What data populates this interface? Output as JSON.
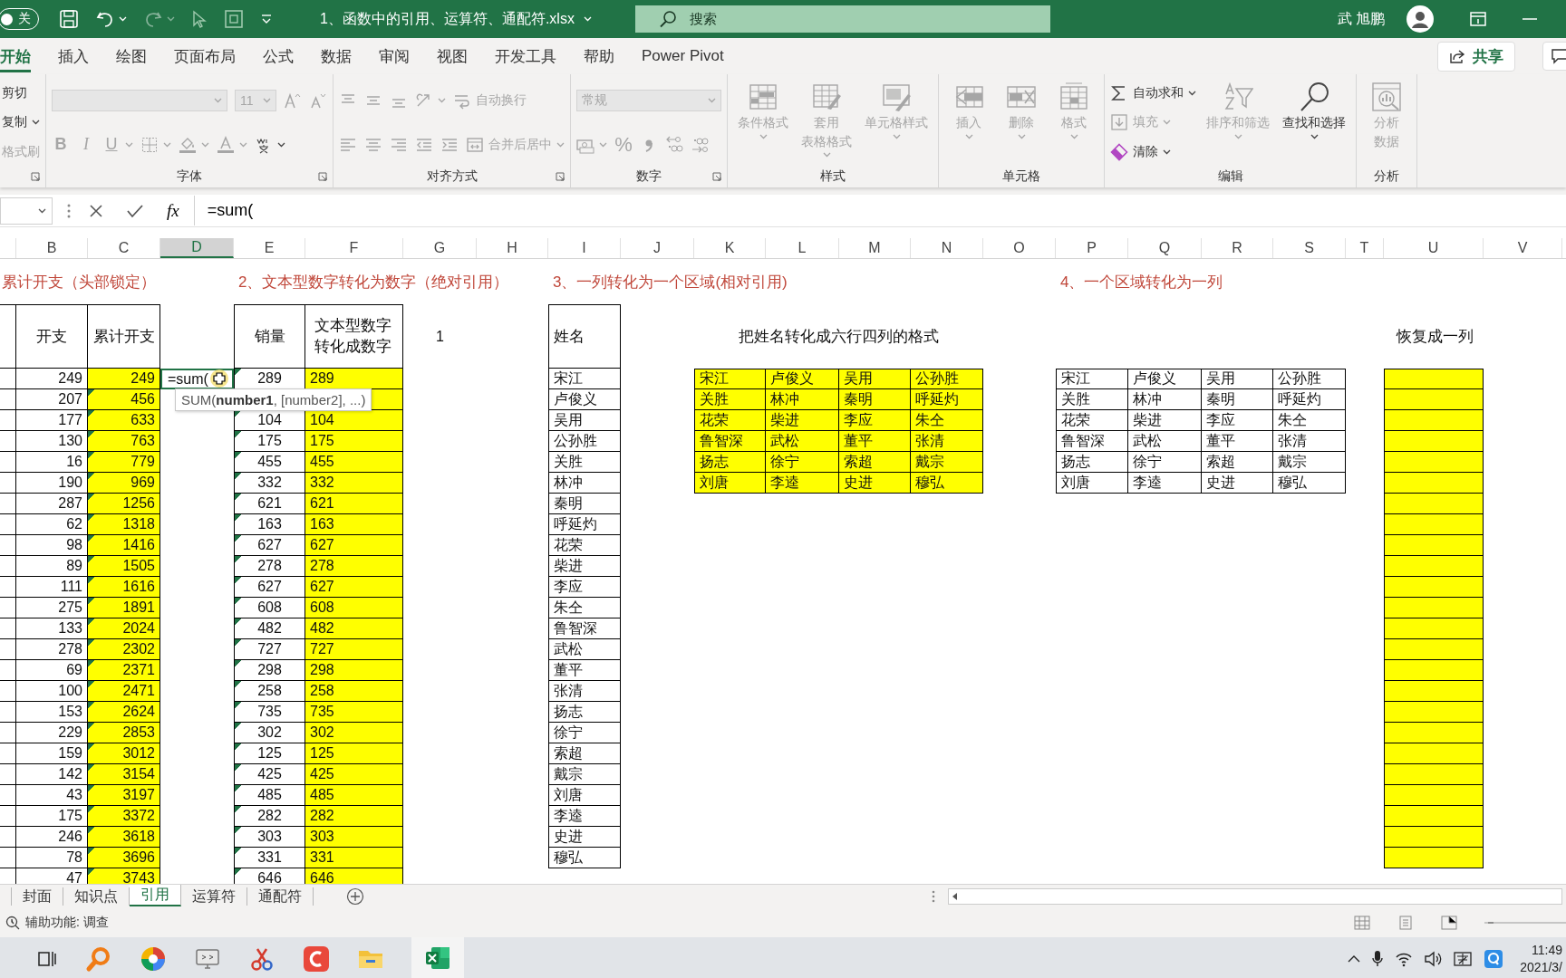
{
  "title_bar": {
    "autosave_label": "关",
    "autosave_on": false,
    "filename": "1、函数中的引用、运算符、通配符.xlsx",
    "search_placeholder": "搜索",
    "user": "武 旭鹏"
  },
  "ribbon_tabs": [
    {
      "label": "开始",
      "selected": true
    },
    {
      "label": "插入",
      "selected": false
    },
    {
      "label": "绘图",
      "selected": false
    },
    {
      "label": "页面布局",
      "selected": false
    },
    {
      "label": "公式",
      "selected": false
    },
    {
      "label": "数据",
      "selected": false
    },
    {
      "label": "审阅",
      "selected": false
    },
    {
      "label": "视图",
      "selected": false
    },
    {
      "label": "开发工具",
      "selected": false
    },
    {
      "label": "帮助",
      "selected": false
    },
    {
      "label": "Power Pivot",
      "selected": false
    }
  ],
  "share_button": "共享",
  "ribbon_groups": [
    {
      "launcher": true,
      "blocks": [
        {
          "rows": [
            [
              {
                "kind": "label",
                "label": "剪切",
                "disabled": false
              }
            ],
            [
              {
                "kind": "label",
                "label": "复制",
                "dropdown": true,
                "disabled": false
              }
            ],
            [
              {
                "kind": "label",
                "label": "格式刷",
                "disabled": true
              }
            ]
          ]
        }
      ]
    },
    {
      "label": "字体",
      "launcher": true,
      "blocks": [
        {
          "rows": [
            [
              {
                "kind": "dropdown",
                "disabled": true
              },
              {
                "kind": "dropdown",
                "value": "11",
                "disabled": true
              },
              {
                "kind": "icon",
                "disabled": true
              },
              {
                "kind": "icon",
                "disabled": true
              }
            ],
            [
              {
                "kind": "char",
                "label": "B",
                "disabled": true
              },
              {
                "kind": "char",
                "label": "I",
                "disabled": true
              },
              {
                "kind": "char",
                "label": "U",
                "dropdown": true,
                "disabled": true
              },
              {
                "kind": "icon",
                "dropdown": true,
                "disabled": true
              },
              {
                "kind": "icon",
                "dropdown": true,
                "disabled": true
              },
              {
                "kind": "icon",
                "dropdown": true,
                "disabled": true
              },
              {
                "kind": "icon",
                "dropdown": true,
                "disabled": false
              }
            ]
          ]
        }
      ]
    },
    {
      "label": "对齐方式",
      "launcher": true,
      "blocks": [
        {
          "rows": [
            [
              {
                "kind": "icon",
                "disabled": true
              },
              {
                "kind": "icon",
                "disabled": true
              },
              {
                "kind": "icon",
                "disabled": true
              },
              {
                "kind": "icon",
                "dropdown": true,
                "disabled": true
              },
              {
                "kind": "small",
                "label": "自动换行",
                "disabled": true
              }
            ],
            [
              {
                "kind": "icon",
                "disabled": true
              },
              {
                "kind": "icon",
                "disabled": true
              },
              {
                "kind": "icon",
                "disabled": true
              },
              {
                "kind": "icon",
                "disabled": true
              },
              {
                "kind": "icon",
                "disabled": true
              },
              {
                "kind": "small",
                "label": "合并后居中",
                "dropdown": true,
                "disabled": true
              }
            ]
          ]
        }
      ]
    },
    {
      "label": "数字",
      "launcher": true,
      "blocks": [
        {
          "rows": [
            [
              {
                "kind": "dropdown",
                "value": "常规",
                "disabled": true
              }
            ],
            [
              {
                "kind": "icon",
                "dropdown": true,
                "disabled": true
              },
              {
                "kind": "char",
                "label": "%",
                "disabled": true
              },
              {
                "kind": "icon",
                "disabled": true
              },
              {
                "kind": "icon",
                "disabled": true
              },
              {
                "kind": "icon",
                "disabled": true
              }
            ]
          ]
        }
      ]
    },
    {
      "label": "样式",
      "blocks": [
        {
          "items": [
            {
              "kind": "large",
              "label": "条件格式",
              "dropdown": true,
              "disabled": true
            },
            {
              "kind": "large",
              "label_lines": [
                "套用",
                "表格格式"
              ],
              "dropdown": true,
              "disabled": true
            },
            {
              "kind": "large",
              "label": "单元格样式",
              "dropdown": true,
              "disabled": true
            }
          ]
        }
      ]
    },
    {
      "label": "单元格",
      "blocks": [
        {
          "items": [
            {
              "kind": "large",
              "label": "插入",
              "dropdown": true,
              "disabled": true
            },
            {
              "kind": "large",
              "label": "删除",
              "dropdown": true,
              "disabled": true
            },
            {
              "kind": "large",
              "label": "格式",
              "dropdown": true,
              "disabled": true
            }
          ]
        }
      ]
    },
    {
      "label": "编辑",
      "blocks": [
        {
          "rows": [
            [
              {
                "kind": "small",
                "label": "自动求和",
                "dropdown": true,
                "disabled": false
              }
            ],
            [
              {
                "kind": "small",
                "label": "填充",
                "dropdown": true,
                "disabled": true
              }
            ],
            [
              {
                "kind": "small",
                "label": "清除",
                "dropdown": true,
                "disabled": false
              }
            ]
          ]
        },
        {
          "items": [
            {
              "kind": "large",
              "label": "排序和筛选",
              "dropdown": true,
              "disabled": true
            },
            {
              "kind": "large",
              "label": "查找和选择",
              "dropdown": true,
              "disabled": false
            }
          ]
        }
      ]
    },
    {
      "label": "分析",
      "blocks": [
        {
          "items": [
            {
              "kind": "large",
              "label_lines": [
                "分析",
                "数据"
              ],
              "disabled": true
            }
          ]
        }
      ]
    }
  ],
  "formula_bar": {
    "fx": "fx",
    "formula": "=sum("
  },
  "sheet": {
    "columns": [
      {
        "label": "B",
        "selected": false
      },
      {
        "label": "C",
        "selected": false
      },
      {
        "label": "D",
        "selected": true
      },
      {
        "label": "E",
        "selected": false
      },
      {
        "label": "F",
        "selected": false
      },
      {
        "label": "G",
        "selected": false
      },
      {
        "label": "H",
        "selected": false
      },
      {
        "label": "I",
        "selected": false
      },
      {
        "label": "J",
        "selected": false
      },
      {
        "label": "K",
        "selected": false
      },
      {
        "label": "L",
        "selected": false
      },
      {
        "label": "M",
        "selected": false
      },
      {
        "label": "N",
        "selected": false
      },
      {
        "label": "O",
        "selected": false
      },
      {
        "label": "P",
        "selected": false
      },
      {
        "label": "Q",
        "selected": false
      },
      {
        "label": "R",
        "selected": false
      },
      {
        "label": "S",
        "selected": false
      },
      {
        "label": "T",
        "selected": false
      },
      {
        "label": "U",
        "selected": false
      },
      {
        "label": "V",
        "selected": false
      }
    ],
    "section_titles": [
      "累计开支（头部锁定）",
      "2、文本型数字转化为数字（绝对引用）",
      "3、一列转化为一个区域(相对引用)",
      "4、一个区域转化为一列"
    ],
    "expenses": {
      "headers": [
        "开支",
        "累计开支"
      ],
      "rows": [
        {
          "expense": "249",
          "total": "249",
          "flagged": false
        },
        {
          "expense": "207",
          "total": "456",
          "flagged": true
        },
        {
          "expense": "177",
          "total": "633",
          "flagged": true
        },
        {
          "expense": "130",
          "total": "763",
          "flagged": true
        },
        {
          "expense": "16",
          "total": "779",
          "flagged": true
        },
        {
          "expense": "190",
          "total": "969",
          "flagged": true
        },
        {
          "expense": "287",
          "total": "1256",
          "flagged": true
        },
        {
          "expense": "62",
          "total": "1318",
          "flagged": true
        },
        {
          "expense": "98",
          "total": "1416",
          "flagged": true
        },
        {
          "expense": "89",
          "total": "1505",
          "flagged": true
        },
        {
          "expense": "111",
          "total": "1616",
          "flagged": true
        },
        {
          "expense": "275",
          "total": "1891",
          "flagged": true
        },
        {
          "expense": "133",
          "total": "2024",
          "flagged": true
        },
        {
          "expense": "278",
          "total": "2302",
          "flagged": true
        },
        {
          "expense": "69",
          "total": "2371",
          "flagged": true
        },
        {
          "expense": "100",
          "total": "2471",
          "flagged": true
        },
        {
          "expense": "153",
          "total": "2624",
          "flagged": true
        },
        {
          "expense": "229",
          "total": "2853",
          "flagged": true
        },
        {
          "expense": "159",
          "total": "3012",
          "flagged": true
        },
        {
          "expense": "142",
          "total": "3154",
          "flagged": true
        },
        {
          "expense": "43",
          "total": "3197",
          "flagged": true
        },
        {
          "expense": "175",
          "total": "3372",
          "flagged": true
        },
        {
          "expense": "246",
          "total": "3618",
          "flagged": true
        },
        {
          "expense": "78",
          "total": "3696",
          "flagged": true
        },
        {
          "expense": "47",
          "total": "3743",
          "flagged": true
        }
      ]
    },
    "active_cell": "=sum(",
    "tooltip": "SUM(**number1**, [number2], ...)",
    "conversion": {
      "headers": [
        "销量",
        "文本型数字转化成数字"
      ],
      "rows": [
        {
          "sales": "289",
          "text": "289",
          "flagged": true
        },
        {},
        {
          "sales": "104",
          "text": "104",
          "flagged": true
        },
        {
          "sales": "175",
          "text": "175",
          "flagged": true
        },
        {
          "sales": "455",
          "text": "455",
          "flagged": true
        },
        {
          "sales": "332",
          "text": "332",
          "flagged": true
        },
        {
          "sales": "621",
          "text": "621",
          "flagged": true
        },
        {
          "sales": "163",
          "text": "163",
          "flagged": true
        },
        {
          "sales": "627",
          "text": "627",
          "flagged": true
        },
        {
          "sales": "278",
          "text": "278",
          "flagged": true
        },
        {
          "sales": "627",
          "text": "627",
          "flagged": true
        },
        {
          "sales": "608",
          "text": "608",
          "flagged": true
        },
        {
          "sales": "482",
          "text": "482",
          "flagged": true
        },
        {
          "sales": "727",
          "text": "727",
          "flagged": true
        },
        {
          "sales": "298",
          "text": "298",
          "flagged": true
        },
        {
          "sales": "258",
          "text": "258",
          "flagged": true
        },
        {
          "sales": "735",
          "text": "735",
          "flagged": true
        },
        {
          "sales": "302",
          "text": "302",
          "flagged": true
        },
        {
          "sales": "125",
          "text": "125",
          "flagged": true
        },
        {
          "sales": "425",
          "text": "425",
          "flagged": true
        },
        {
          "sales": "485",
          "text": "485",
          "flagged": true
        },
        {
          "sales": "282",
          "text": "282",
          "flagged": true
        },
        {
          "sales": "303",
          "text": "303",
          "flagged": true
        },
        {
          "sales": "331",
          "text": "331",
          "flagged": true
        },
        {
          "sales": "646",
          "text": "646",
          "flagged": true
        }
      ]
    },
    "g_value": "1",
    "names": {
      "header": "姓名",
      "rows": [
        "宋江",
        "卢俊义",
        "吴用",
        "公孙胜",
        "关胜",
        "林冲",
        "秦明",
        "呼延灼",
        "花荣",
        "柴进",
        "李应",
        "朱仝",
        "鲁智深",
        "武松",
        "董平",
        "张清",
        "扬志",
        "徐宁",
        "索超",
        "戴宗",
        "刘唐",
        "李逵",
        "史进",
        "穆弘"
      ]
    },
    "grid_title": "把姓名转化成六行四列的格式",
    "grid": [
      [
        "宋江",
        "卢俊义",
        "吴用",
        "公孙胜"
      ],
      [
        "关胜",
        "林冲",
        "秦明",
        "呼延灼"
      ],
      [
        "花荣",
        "柴进",
        "李应",
        "朱仝"
      ],
      [
        "鲁智深",
        "武松",
        "董平",
        "张清"
      ],
      [
        "扬志",
        "徐宁",
        "索超",
        "戴宗"
      ],
      [
        "刘唐",
        "李逵",
        "史进",
        "穆弘"
      ]
    ],
    "grid_copy": [
      [
        "宋江",
        "卢俊义",
        "吴用",
        "公孙胜"
      ],
      [
        "关胜",
        "林冲",
        "秦明",
        "呼延灼"
      ],
      [
        "花荣",
        "柴进",
        "李应",
        "朱仝"
      ],
      [
        "鲁智深",
        "武松",
        "董平",
        "张清"
      ],
      [
        "扬志",
        "徐宁",
        "索超",
        "戴宗"
      ],
      [
        "刘唐",
        "李逵",
        "史进",
        "穆弘"
      ]
    ],
    "restore_header": "恢复成一列"
  },
  "sheet_tabs": [
    {
      "label": "封面",
      "selected": false
    },
    {
      "label": "知识点",
      "selected": false
    },
    {
      "label": "引用",
      "selected": true
    },
    {
      "label": "运算符",
      "selected": false
    },
    {
      "label": "通配符",
      "selected": false
    }
  ],
  "status_bar": {
    "accessibility": "辅助功能: 调查"
  },
  "taskbar": {
    "time": "11:49",
    "date": "2021/3/"
  }
}
